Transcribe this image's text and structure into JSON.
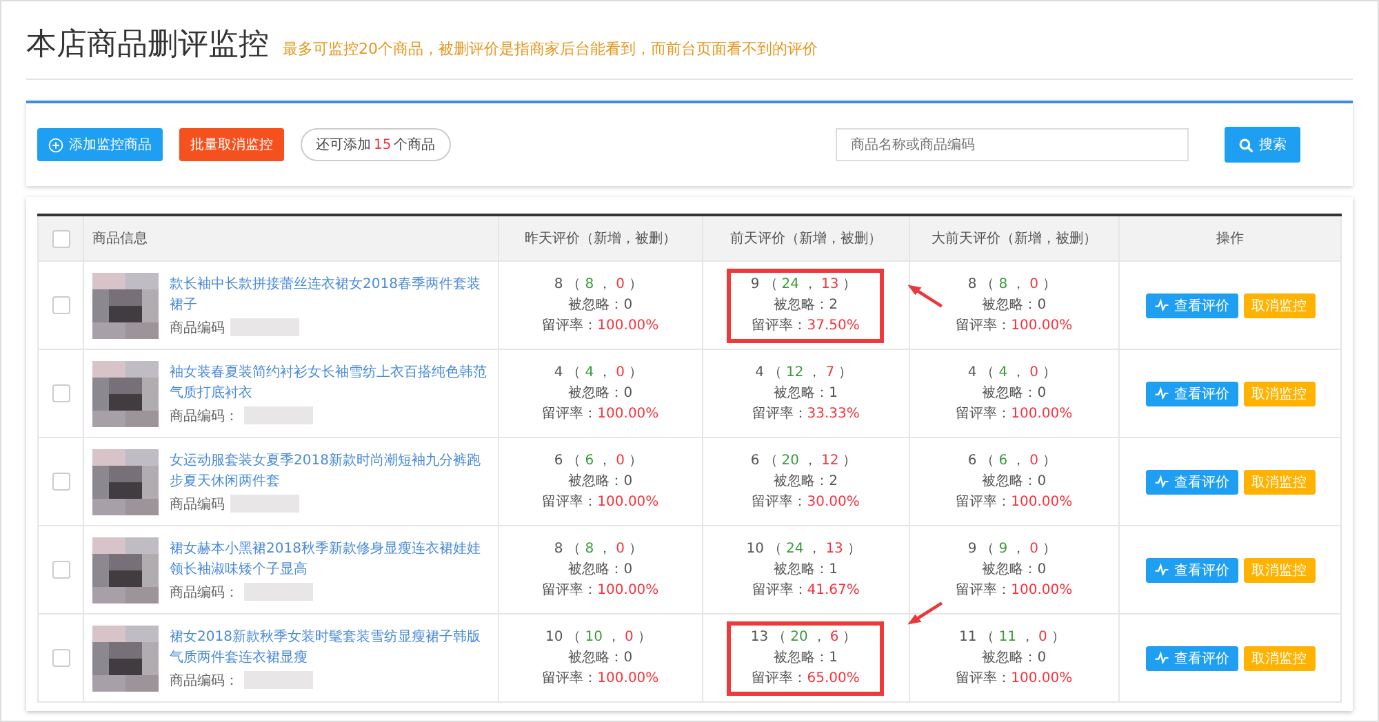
{
  "header": {
    "title": "本店商品删评监控",
    "note": "最多可监控20个商品，被删评价是指商家后台能看到，而前台页面看不到的评价"
  },
  "toolbar": {
    "add_button": "添加监控商品",
    "batch_cancel_button": "批量取消监控",
    "quota": {
      "before": "还可添加",
      "count": "15",
      "after": "个商品"
    },
    "search": {
      "placeholder": "商品名称或商品编码"
    },
    "search_button": "搜索"
  },
  "table": {
    "select_all": {
      "checked": false
    },
    "info_column": "商品信息",
    "review_columns": [
      "昨天评价（新增，被删）",
      "前天评价（新增，被删）",
      "大前天评价（新增，被删）"
    ],
    "action_column": "操作",
    "rows": [
      {
        "checked": false,
        "title": "款长袖中长款拼接蕾丝连衣裙女2018春季两件套装裙子",
        "code_label": "商品编码",
        "view_button": "查看评价",
        "cancel_button": "取消监控",
        "cells": [
          {
            "total": "8",
            "open": "（",
            "added": "8",
            "sep": "，",
            "deleted": "0",
            "close": "）",
            "ignored_label": "被忽略：",
            "ignored": "0",
            "rate_label": "留评率：",
            "rate": "100.00%",
            "highlighted": false
          },
          {
            "total": "9",
            "open": "（",
            "added": "24",
            "sep": "，",
            "deleted": "13",
            "close": "）",
            "ignored_label": "被忽略：",
            "ignored": "2",
            "rate_label": "留评率：",
            "rate": "37.50%",
            "highlighted": true
          },
          {
            "total": "8",
            "open": "（",
            "added": "8",
            "sep": "，",
            "deleted": "0",
            "close": "）",
            "ignored_label": "被忽略：",
            "ignored": "0",
            "rate_label": "留评率：",
            "rate": "100.00%",
            "highlighted": false
          }
        ]
      },
      {
        "checked": false,
        "title": "袖女装春夏装简约衬衫女长袖雪纺上衣百搭纯色韩范气质打底衬衣",
        "code_label": "商品编码：",
        "view_button": "查看评价",
        "cancel_button": "取消监控",
        "cells": [
          {
            "total": "4",
            "open": "（",
            "added": "4",
            "sep": "，",
            "deleted": "0",
            "close": "）",
            "ignored_label": "被忽略：",
            "ignored": "0",
            "rate_label": "留评率：",
            "rate": "100.00%",
            "highlighted": false
          },
          {
            "total": "4",
            "open": "（",
            "added": "12",
            "sep": "，",
            "deleted": "7",
            "close": "）",
            "ignored_label": "被忽略：",
            "ignored": "1",
            "rate_label": "留评率：",
            "rate": "33.33%",
            "highlighted": false
          },
          {
            "total": "4",
            "open": "（",
            "added": "4",
            "sep": "，",
            "deleted": "0",
            "close": "）",
            "ignored_label": "被忽略：",
            "ignored": "0",
            "rate_label": "留评率：",
            "rate": "100.00%",
            "highlighted": false
          }
        ]
      },
      {
        "checked": false,
        "title": "女运动服套装女夏季2018新款时尚潮短袖九分裤跑步夏天休闲两件套",
        "code_label": "商品编码",
        "view_button": "查看评价",
        "cancel_button": "取消监控",
        "cells": [
          {
            "total": "6",
            "open": "（",
            "added": "6",
            "sep": "，",
            "deleted": "0",
            "close": "）",
            "ignored_label": "被忽略：",
            "ignored": "0",
            "rate_label": "留评率：",
            "rate": "100.00%",
            "highlighted": false
          },
          {
            "total": "6",
            "open": "（",
            "added": "20",
            "sep": "，",
            "deleted": "12",
            "close": "）",
            "ignored_label": "被忽略：",
            "ignored": "2",
            "rate_label": "留评率：",
            "rate": "30.00%",
            "highlighted": false
          },
          {
            "total": "6",
            "open": "（",
            "added": "6",
            "sep": "，",
            "deleted": "0",
            "close": "）",
            "ignored_label": "被忽略：",
            "ignored": "0",
            "rate_label": "留评率：",
            "rate": "100.00%",
            "highlighted": false
          }
        ]
      },
      {
        "checked": false,
        "title": "裙女赫本小黑裙2018秋季新款修身显瘦连衣裙娃娃领长袖淑味矮个子显高",
        "code_label": "商品编码：",
        "view_button": "查看评价",
        "cancel_button": "取消监控",
        "cells": [
          {
            "total": "8",
            "open": "（",
            "added": "8",
            "sep": "，",
            "deleted": "0",
            "close": "）",
            "ignored_label": "被忽略：",
            "ignored": "0",
            "rate_label": "留评率：",
            "rate": "100.00%",
            "highlighted": false
          },
          {
            "total": "10",
            "open": "（",
            "added": "24",
            "sep": "，",
            "deleted": "13",
            "close": "）",
            "ignored_label": "被忽略：",
            "ignored": "1",
            "rate_label": "留评率：",
            "rate": "41.67%",
            "highlighted": false
          },
          {
            "total": "9",
            "open": "（",
            "added": "9",
            "sep": "，",
            "deleted": "0",
            "close": "）",
            "ignored_label": "被忽略：",
            "ignored": "0",
            "rate_label": "留评率：",
            "rate": "100.00%",
            "highlighted": false
          }
        ]
      },
      {
        "checked": false,
        "title": "裙女2018新款秋季女装时髦套装雪纺显瘦裙子韩版气质两件套连衣裙显瘦",
        "code_label": "商品编码：",
        "view_button": "查看评价",
        "cancel_button": "取消监控",
        "cells": [
          {
            "total": "10",
            "open": "（",
            "added": "10",
            "sep": "，",
            "deleted": "0",
            "close": "）",
            "ignored_label": "被忽略：",
            "ignored": "0",
            "rate_label": "留评率：",
            "rate": "100.00%",
            "highlighted": false
          },
          {
            "total": "13",
            "open": "（",
            "added": "20",
            "sep": "，",
            "deleted": "6",
            "close": "）",
            "ignored_label": "被忽略：",
            "ignored": "1",
            "rate_label": "留评率：",
            "rate": "65.00%",
            "highlighted": true
          },
          {
            "total": "11",
            "open": "（",
            "added": "11",
            "sep": "，",
            "deleted": "0",
            "close": "）",
            "ignored_label": "被忽略：",
            "ignored": "0",
            "rate_label": "留评率：",
            "rate": "100.00%",
            "highlighted": false
          }
        ]
      }
    ]
  }
}
